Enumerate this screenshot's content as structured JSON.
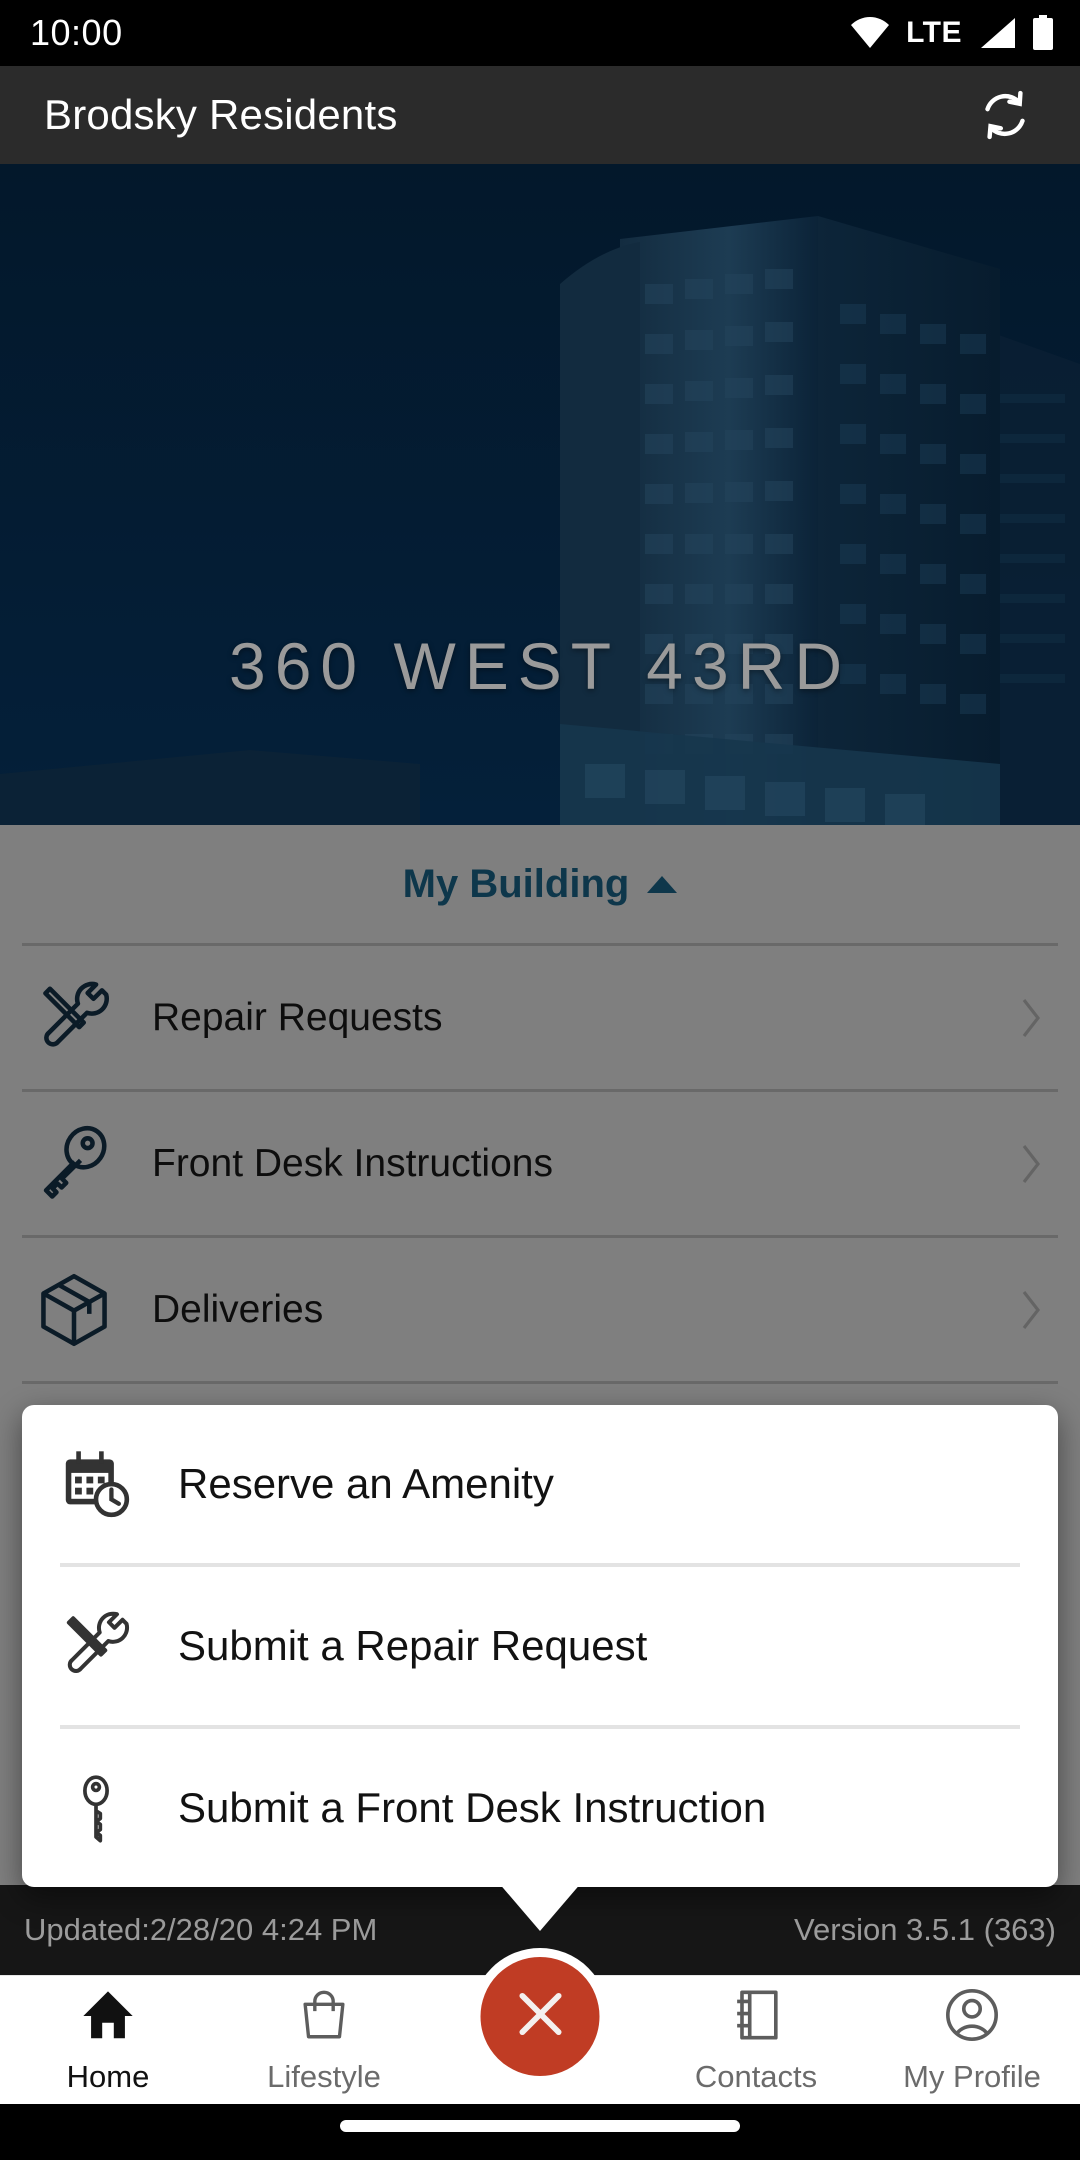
{
  "status_bar": {
    "time": "10:00",
    "network_label": "LTE",
    "icons": [
      "wifi-icon",
      "signal-icon",
      "battery-icon"
    ]
  },
  "app_bar": {
    "title": "Brodsky Residents",
    "action_icon": "refresh-icon"
  },
  "hero": {
    "building_name": "360 WEST 43RD",
    "image": "building-photo",
    "background_color": "#03192d",
    "text_color": "#9a9a9a"
  },
  "my_building": {
    "section_label": "My Building",
    "expanded_icon": "caret-up-icon",
    "accent_color": "#1d6e96",
    "rows": [
      {
        "label": "Repair Requests",
        "icon": "tools-icon",
        "chevron": "chevron-right-icon"
      },
      {
        "label": "Front Desk Instructions",
        "icon": "key-icon",
        "chevron": "chevron-right-icon"
      },
      {
        "label": "Deliveries",
        "icon": "package-icon",
        "chevron": "chevron-right-icon"
      }
    ]
  },
  "popup_menu": {
    "items": [
      {
        "label": "Reserve an Amenity",
        "icon": "calendar-clock-icon"
      },
      {
        "label": "Submit a Repair Request",
        "icon": "tools-icon"
      },
      {
        "label": "Submit a Front Desk Instruction",
        "icon": "key-icon"
      }
    ]
  },
  "meta_bar": {
    "updated": "Updated:2/28/20 4:24 PM",
    "version": "Version 3.5.1 (363)"
  },
  "bottom_nav": {
    "items": [
      {
        "label": "Home",
        "icon": "home-icon",
        "active": true
      },
      {
        "label": "Lifestyle",
        "icon": "shopping-bag-icon",
        "active": false
      },
      {
        "label": "Contacts",
        "icon": "address-book-icon",
        "active": false
      },
      {
        "label": "My Profile",
        "icon": "user-circle-icon",
        "active": false
      }
    ],
    "fab": {
      "icon": "close-icon",
      "color": "#c03c24"
    }
  }
}
